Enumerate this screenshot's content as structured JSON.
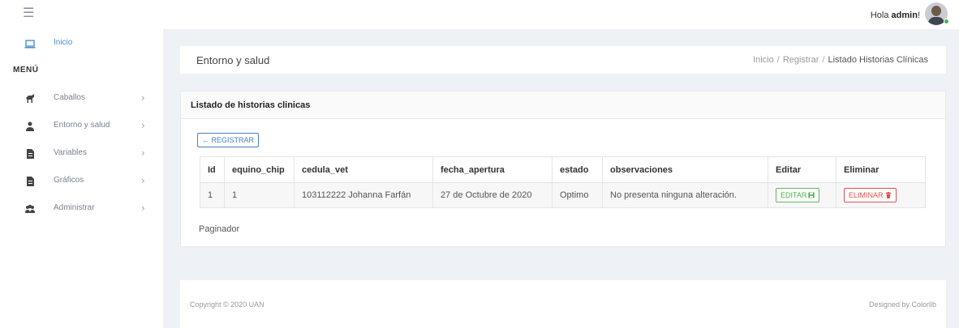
{
  "topbar": {
    "menu_icon": "hamburger-icon",
    "greeting": "Hola ",
    "username": "admin",
    "greeting_suffix": "!"
  },
  "sidebar": {
    "home_label": "Inicio",
    "menu_title": "MENÚ",
    "items": [
      {
        "label": "Caballos",
        "icon": "horse-icon"
      },
      {
        "label": "Entorno y salud",
        "icon": "user-icon"
      },
      {
        "label": "Variables",
        "icon": "file-icon"
      },
      {
        "label": "Gráficos",
        "icon": "file-icon"
      },
      {
        "label": "Administrar",
        "icon": "users-icon"
      }
    ],
    "chevron": "›"
  },
  "header": {
    "title": "Entorno y salud",
    "breadcrumb": [
      "Inicio",
      "Registrar",
      "Listado Historias Clínicas"
    ],
    "separator": "/"
  },
  "list": {
    "title": "Listado de historias clinicas",
    "register_label": "REGISTRAR",
    "columns": [
      "Id",
      "equino_chip",
      "cedula_vet",
      "fecha_apertura",
      "estado",
      "observaciones",
      "Editar",
      "Eliminar"
    ],
    "rows": [
      {
        "id": "1",
        "equino_chip": "1",
        "cedula_vet": "103112222 Johanna Farfán",
        "fecha_apertura": "27 de Octubre de 2020",
        "estado": "Optimo",
        "observaciones": "No presenta ninguna alteración.",
        "edit_label": "EDITAR",
        "delete_label": "ELIMINAR"
      }
    ],
    "pager_label": "Paginador"
  },
  "footer": {
    "copyright": "Copyright © 2020 UAN",
    "designed": "Designed by Colorlib"
  },
  "colors": {
    "accent": "#4a90d9",
    "edit": "#5cb85c",
    "delete": "#d9534f",
    "background": "#eef1f5"
  }
}
